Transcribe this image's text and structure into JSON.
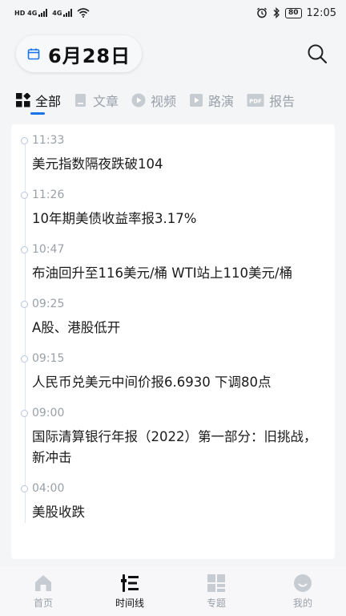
{
  "status_bar": {
    "sim1": "HD 4G",
    "sim2": "4G",
    "battery": "80",
    "time": "12:05"
  },
  "header": {
    "date": "6月28日",
    "icons": {
      "calendar": "calendar-icon",
      "search": "search-icon"
    }
  },
  "tabs": [
    {
      "label": "全部",
      "icon": "grid-icon",
      "active": true
    },
    {
      "label": "文章",
      "icon": "document-icon",
      "active": false
    },
    {
      "label": "视频",
      "icon": "play-circle-icon",
      "active": false
    },
    {
      "label": "路演",
      "icon": "play-square-icon",
      "active": false
    },
    {
      "label": "报告",
      "icon": "pdf-icon",
      "active": false
    }
  ],
  "timeline": [
    {
      "time": "11:33",
      "headline": "美元指数隔夜跌破104"
    },
    {
      "time": "11:26",
      "headline": "10年期美债收益率报3.17%"
    },
    {
      "time": "10:47",
      "headline": "布油回升至116美元/桶 WTI站上110美元/桶"
    },
    {
      "time": "09:25",
      "headline": "A股、港股低开"
    },
    {
      "time": "09:15",
      "headline": "人民币兑美元中间价报6.6930 下调80点"
    },
    {
      "time": "09:00",
      "headline": "国际清算银行年报（2022）第一部分：旧挑战，新冲击"
    },
    {
      "time": "04:00",
      "headline": "美股收跌"
    }
  ],
  "bottom_nav": [
    {
      "label": "首页",
      "icon": "home-icon",
      "active": false
    },
    {
      "label": "时间线",
      "icon": "timeline-icon",
      "active": true
    },
    {
      "label": "专题",
      "icon": "tiles-icon",
      "active": false
    },
    {
      "label": "我的",
      "icon": "profile-icon",
      "active": false
    }
  ],
  "colors": {
    "accent": "#1a73e8",
    "muted": "#9aa0a8",
    "background": "#f4f5f7"
  }
}
